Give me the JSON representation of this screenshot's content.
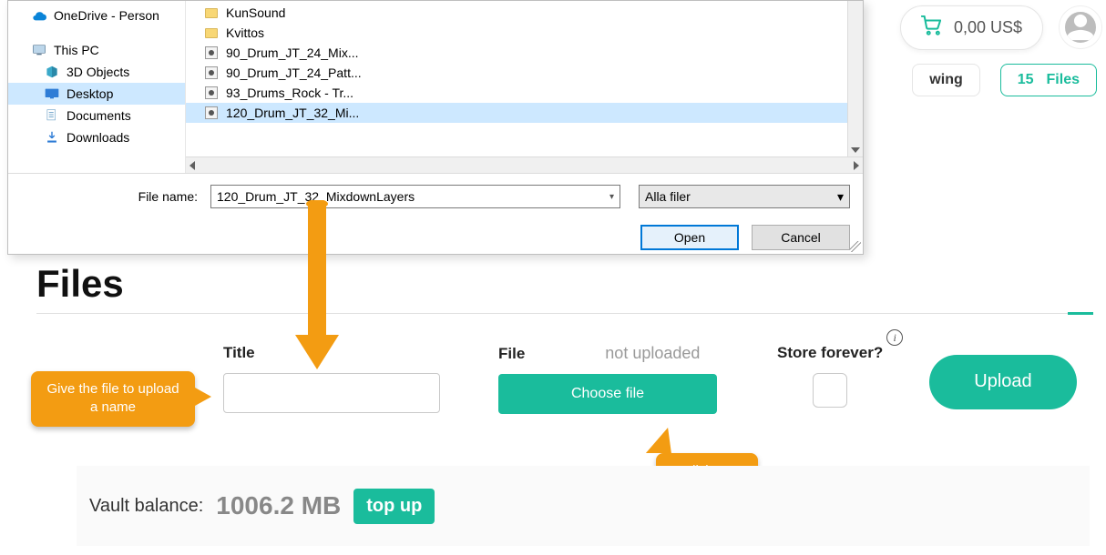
{
  "header": {
    "cart_amount": "0,00 US$"
  },
  "side_chips": {
    "partial": "wing",
    "files_count": "15",
    "files_label": "Files"
  },
  "file_dialog": {
    "nav": {
      "onedrive": "OneDrive - Person",
      "thispc": "This PC",
      "objects3d": "3D Objects",
      "desktop": "Desktop",
      "documents": "Documents",
      "downloads": "Downloads"
    },
    "list": {
      "folder1": "KunSound",
      "folder2": "Kvittos",
      "file1": "90_Drum_JT_24_Mix...",
      "file2": "90_Drum_JT_24_Patt...",
      "file3": "93_Drums_Rock - Tr...",
      "file4": "120_Drum_JT_32_Mi..."
    },
    "filename_label": "File name:",
    "filename_value": "120_Drum_JT_32_MixdownLayers",
    "filter_value": "Alla filer",
    "open_label": "Open",
    "cancel_label": "Cancel"
  },
  "page": {
    "title": "Files",
    "form": {
      "title_label": "Title",
      "file_label": "File",
      "not_uploaded": "not uploaded",
      "choose_file": "Choose file",
      "store_label": "Store forever?",
      "upload": "Upload"
    },
    "vault": {
      "label": "Vault balance:",
      "value": "1006.2 MB",
      "topup": "top up"
    }
  },
  "annotations": {
    "give_name": "Give the file to upload a name",
    "click_choose": "Click on Choose File"
  }
}
